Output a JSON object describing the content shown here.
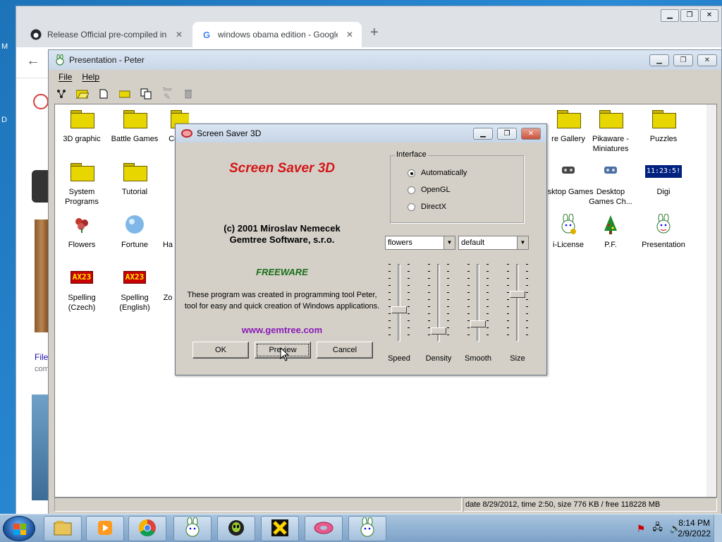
{
  "browser": {
    "tabs": [
      {
        "title": "Release Official pre-compiled ins",
        "icon": "github-icon",
        "active": false
      },
      {
        "title": "windows obama edition - Google",
        "icon": "google-icon",
        "active": true
      }
    ],
    "new_tab": "+",
    "back": "←",
    "page_snippets": {
      "left_text_1": "File",
      "left_text_2": "com"
    }
  },
  "desktop_edge": {
    "m": "M",
    "d": "D"
  },
  "window": {
    "title": "Presentation - Peter",
    "menu": [
      "File",
      "Help"
    ],
    "toolbar_icons": [
      "tree-icon",
      "open-folder-icon",
      "new-file-icon",
      "folder-icon",
      "copy-icon",
      "text-icon",
      "trash-icon"
    ],
    "toolbar_text_label": "Text",
    "items": [
      {
        "label": "3D graphic",
        "kind": "folder"
      },
      {
        "label": "Battle Games",
        "kind": "folder"
      },
      {
        "label": "Cor",
        "kind": "folder"
      },
      {
        "label": "re Gallery",
        "kind": "folder"
      },
      {
        "label": "Pikaware - Miniatures",
        "kind": "folder"
      },
      {
        "label": "Puzzles",
        "kind": "folder"
      },
      {
        "label": "System Programs",
        "kind": "folder"
      },
      {
        "label": "Tutorial",
        "kind": "folder"
      },
      {
        "label": "esktop Games",
        "kind": "app"
      },
      {
        "label": "Desktop Games Ch...",
        "kind": "app"
      },
      {
        "label": "Digi",
        "kind": "clock",
        "glyph": "11:23:5!"
      },
      {
        "label": "Flowers",
        "kind": "app"
      },
      {
        "label": "Fortune",
        "kind": "app"
      },
      {
        "label": "Ha",
        "kind": "app"
      },
      {
        "label": "i-License",
        "kind": "app"
      },
      {
        "label": "P.F.",
        "kind": "app"
      },
      {
        "label": "Presentation",
        "kind": "app"
      },
      {
        "label": "Spelling (Czech)",
        "kind": "spell",
        "glyph": "AX23"
      },
      {
        "label": "Spelling (English)",
        "kind": "spell",
        "glyph": "AX23"
      },
      {
        "label": "Zo",
        "kind": "app"
      }
    ],
    "status": "date 8/29/2012, time 2:50, size 776 KB / free 118228 MB"
  },
  "dialog": {
    "title": "Screen Saver 3D",
    "brand": "Screen Saver 3D",
    "copyright_1": "(c) 2001 Miroslav Nemecek",
    "copyright_2": "Gemtree Software, s.r.o.",
    "freeware": "FREEWARE",
    "desc_1": "These program was created in programming tool Peter,",
    "desc_2": "tool for easy and quick creation of Windows applications.",
    "url": "www.gemtree.com",
    "buttons": {
      "ok": "OK",
      "preview": "Preview",
      "cancel": "Cancel"
    },
    "interface": {
      "legend": "Interface",
      "options": [
        {
          "label": "Automatically",
          "selected": true
        },
        {
          "label": "OpenGL",
          "selected": false
        },
        {
          "label": "DirectX",
          "selected": false
        }
      ]
    },
    "scene_select": "flowers",
    "style_select": "default",
    "sliders": [
      {
        "label": "Speed",
        "level": 0.6
      },
      {
        "label": "Density",
        "level": 0.9
      },
      {
        "label": "Smooth",
        "level": 0.8
      },
      {
        "label": "Size",
        "level": 0.38
      }
    ]
  },
  "taskbar": {
    "clock_time": "8:14 PM",
    "clock_date": "2/9/2022",
    "pinned": [
      "explorer-icon",
      "media-player-icon",
      "chrome-icon",
      "peter-rabbit-icon",
      "alien-icon",
      "x-app-icon",
      "donut-icon",
      "peter-rabbit-icon"
    ]
  }
}
